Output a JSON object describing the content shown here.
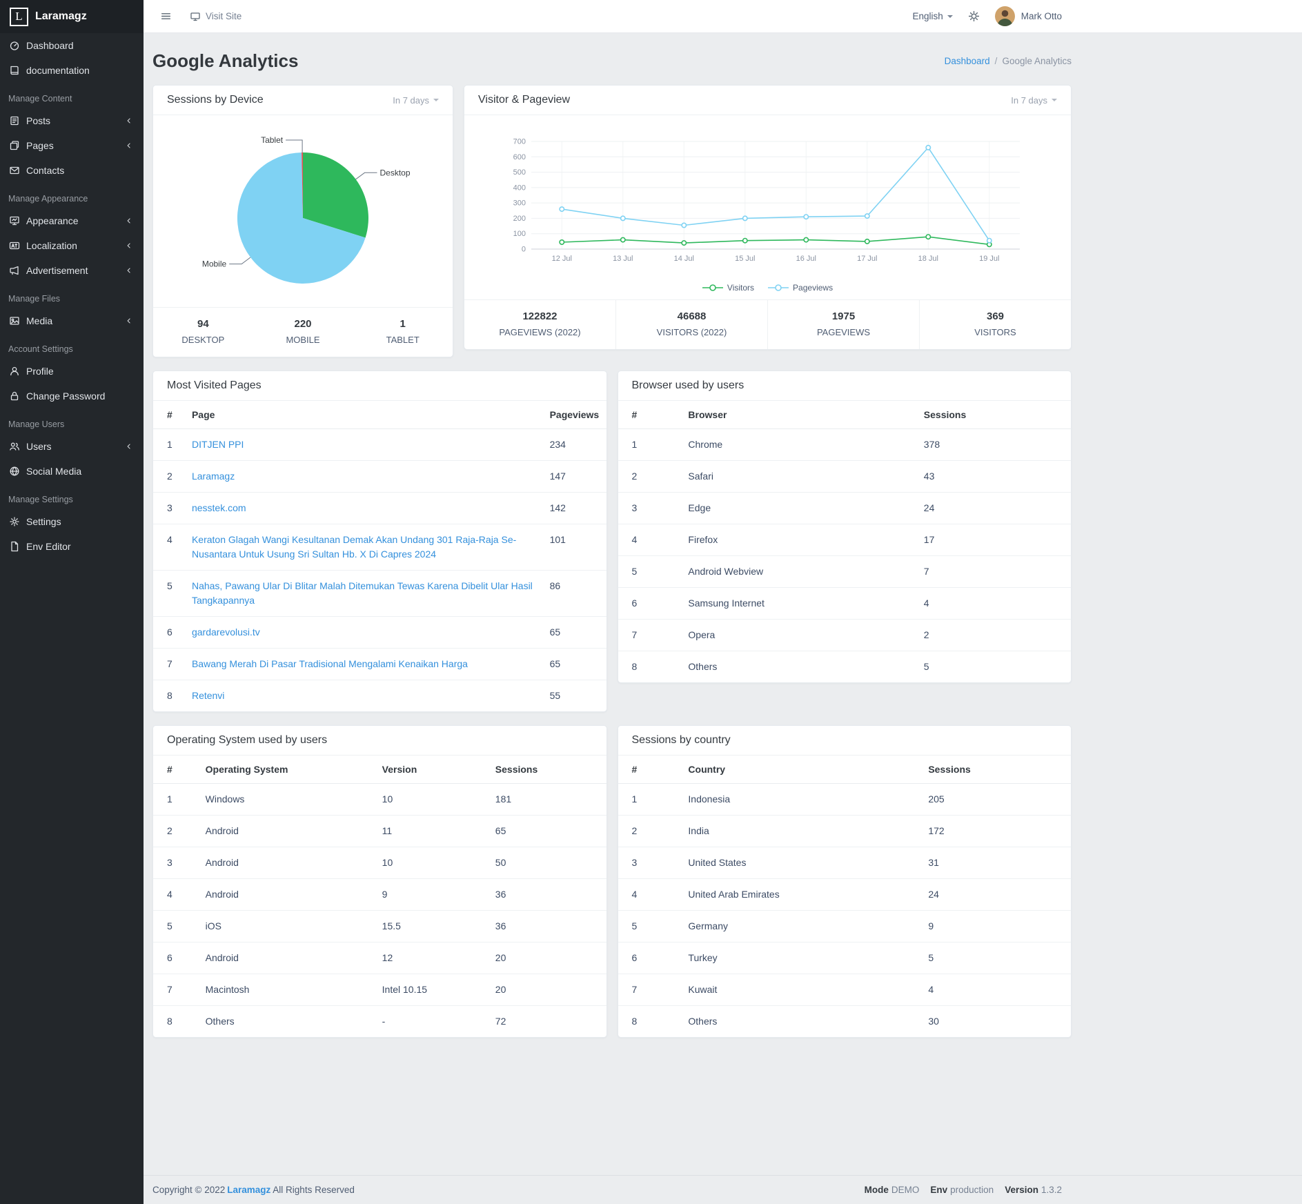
{
  "app": {
    "name": "Laramagz",
    "logo_letter": "L"
  },
  "topbar": {
    "visit_site": "Visit Site",
    "language": "English",
    "user_name": "Mark Otto"
  },
  "sidebar": {
    "sections": [
      {
        "header": null,
        "items": [
          {
            "label": "Dashboard",
            "icon": "dashboard-icon",
            "chevron": false
          },
          {
            "label": "documentation",
            "icon": "book-icon",
            "chevron": false
          }
        ]
      },
      {
        "header": "Manage Content",
        "items": [
          {
            "label": "Posts",
            "icon": "posts-icon",
            "chevron": true
          },
          {
            "label": "Pages",
            "icon": "pages-icon",
            "chevron": true
          },
          {
            "label": "Contacts",
            "icon": "envelope-icon",
            "chevron": false
          }
        ]
      },
      {
        "header": "Manage Appearance",
        "items": [
          {
            "label": "Appearance",
            "icon": "appearance-icon",
            "chevron": true
          },
          {
            "label": "Localization",
            "icon": "language-icon",
            "chevron": true
          },
          {
            "label": "Advertisement",
            "icon": "bullhorn-icon",
            "chevron": true
          }
        ]
      },
      {
        "header": "Manage Files",
        "items": [
          {
            "label": "Media",
            "icon": "media-icon",
            "chevron": true
          }
        ]
      },
      {
        "header": "Account Settings",
        "items": [
          {
            "label": "Profile",
            "icon": "user-icon",
            "chevron": false
          },
          {
            "label": "Change Password",
            "icon": "lock-icon",
            "chevron": false
          }
        ]
      },
      {
        "header": "Manage Users",
        "items": [
          {
            "label": "Users",
            "icon": "users-icon",
            "chevron": true
          },
          {
            "label": "Social Media",
            "icon": "globe-icon",
            "chevron": false
          }
        ]
      },
      {
        "header": "Manage Settings",
        "items": [
          {
            "label": "Settings",
            "icon": "cogs-icon",
            "chevron": false
          },
          {
            "label": "Env Editor",
            "icon": "file-icon",
            "chevron": false
          }
        ]
      }
    ]
  },
  "page": {
    "title": "Google Analytics",
    "breadcrumb_link": "Dashboard",
    "breadcrumb_separator": "/",
    "breadcrumb_current": "Google Analytics"
  },
  "chart_data": [
    {
      "type": "pie",
      "title": "Sessions by Device",
      "period": "In 7 days",
      "labels": [
        "Desktop",
        "Mobile",
        "Tablet"
      ],
      "values": [
        94,
        220,
        1
      ],
      "colors": [
        "#2eb85c",
        "#7fd2f3",
        "#e55353"
      ],
      "legend_position": "callout-labels"
    },
    {
      "type": "line",
      "title": "Visitor & Pageview",
      "period": "In 7 days",
      "x": [
        "12 Jul",
        "13 Jul",
        "14 Jul",
        "15 Jul",
        "16 Jul",
        "17 Jul",
        "18 Jul",
        "19 Jul"
      ],
      "series": [
        {
          "name": "Visitors",
          "color": "#2eb85c",
          "values": [
            45,
            60,
            40,
            55,
            60,
            50,
            80,
            30
          ]
        },
        {
          "name": "Pageviews",
          "color": "#7fd2f3",
          "values": [
            260,
            200,
            155,
            200,
            210,
            215,
            660,
            55
          ]
        }
      ],
      "ylim": [
        0,
        700
      ],
      "yticks": [
        0,
        100,
        200,
        300,
        400,
        500,
        600,
        700
      ],
      "grid": true,
      "legend_position": "bottom"
    }
  ],
  "cards": {
    "sessions_by_device": {
      "stats": [
        {
          "value": "94",
          "label": "DESKTOP"
        },
        {
          "value": "220",
          "label": "MOBILE"
        },
        {
          "value": "1",
          "label": "TABLET"
        }
      ]
    },
    "visitor_pageview": {
      "stats": [
        {
          "value": "122822",
          "label": "PAGEVIEWS (2022)"
        },
        {
          "value": "46688",
          "label": "VISITORS (2022)"
        },
        {
          "value": "1975",
          "label": "PAGEVIEWS"
        },
        {
          "value": "369",
          "label": "VISITORS"
        }
      ]
    }
  },
  "tables": {
    "most_visited": {
      "title": "Most Visited Pages",
      "columns": [
        "#",
        "Page",
        "Pageviews"
      ],
      "col_widths": [
        "7%",
        "79%",
        "14%"
      ],
      "link_col": 1,
      "rows": [
        [
          "1",
          "DITJEN PPI",
          "234"
        ],
        [
          "2",
          "Laramagz",
          "147"
        ],
        [
          "3",
          "nesstek.com",
          "142"
        ],
        [
          "4",
          "Keraton Glagah Wangi Kesultanan Demak Akan Undang 301 Raja-Raja Se- Nusantara Untuk Usung Sri Sultan Hb. X Di Capres 2024",
          "101"
        ],
        [
          "5",
          "Nahas, Pawang Ular Di Blitar Malah Ditemukan Tewas Karena Dibelit Ular Hasil Tangkapannya",
          "86"
        ],
        [
          "6",
          "gardarevolusi.tv",
          "65"
        ],
        [
          "7",
          "Bawang Merah Di Pasar Tradisional Mengalami Kenaikan Harga",
          "65"
        ],
        [
          "8",
          "Retenvi",
          "55"
        ]
      ]
    },
    "browsers": {
      "title": "Browser used by users",
      "columns": [
        "#",
        "Browser",
        "Sessions"
      ],
      "col_widths": [
        "14%",
        "52%",
        "34%"
      ],
      "rows": [
        [
          "1",
          "Chrome",
          "378"
        ],
        [
          "2",
          "Safari",
          "43"
        ],
        [
          "3",
          "Edge",
          "24"
        ],
        [
          "4",
          "Firefox",
          "17"
        ],
        [
          "5",
          "Android Webview",
          "7"
        ],
        [
          "6",
          "Samsung Internet",
          "4"
        ],
        [
          "7",
          "Opera",
          "2"
        ],
        [
          "8",
          "Others",
          "5"
        ]
      ]
    },
    "os": {
      "title": "Operating System used by users",
      "columns": [
        "#",
        "Operating System",
        "Version",
        "Sessions"
      ],
      "col_widths": [
        "10%",
        "39%",
        "25%",
        "26%"
      ],
      "rows": [
        [
          "1",
          "Windows",
          "10",
          "181"
        ],
        [
          "2",
          "Android",
          "11",
          "65"
        ],
        [
          "3",
          "Android",
          "10",
          "50"
        ],
        [
          "4",
          "Android",
          "9",
          "36"
        ],
        [
          "5",
          "iOS",
          "15.5",
          "36"
        ],
        [
          "6",
          "Android",
          "12",
          "20"
        ],
        [
          "7",
          "Macintosh",
          "Intel 10.15",
          "20"
        ],
        [
          "8",
          "Others",
          "-",
          "72"
        ]
      ]
    },
    "countries": {
      "title": "Sessions by country",
      "columns": [
        "#",
        "Country",
        "Sessions"
      ],
      "col_widths": [
        "14%",
        "53%",
        "33%"
      ],
      "rows": [
        [
          "1",
          "Indonesia",
          "205"
        ],
        [
          "2",
          "India",
          "172"
        ],
        [
          "3",
          "United States",
          "31"
        ],
        [
          "4",
          "United Arab Emirates",
          "24"
        ],
        [
          "5",
          "Germany",
          "9"
        ],
        [
          "6",
          "Turkey",
          "5"
        ],
        [
          "7",
          "Kuwait",
          "4"
        ],
        [
          "8",
          "Others",
          "30"
        ]
      ]
    }
  },
  "footer": {
    "copyright_prefix": "Copyright © 2022",
    "brand": "Laramagz",
    "copyright_suffix": "All Rights Reserved",
    "meta": [
      {
        "label": "Mode",
        "value": "DEMO"
      },
      {
        "label": "Env",
        "value": "production"
      },
      {
        "label": "Version",
        "value": "1.3.2"
      }
    ]
  }
}
